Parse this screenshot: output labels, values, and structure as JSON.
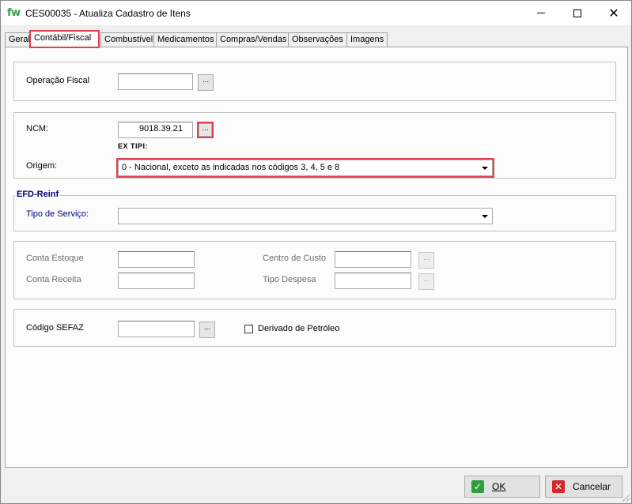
{
  "window": {
    "logo": "fw",
    "title": "CES00035 - Atualiza Cadastro de Itens",
    "controls": {
      "minimize": "minimize-icon",
      "maximize": "maximize-icon",
      "close": "close-icon"
    }
  },
  "tabs": [
    {
      "label": "Geral",
      "active": false
    },
    {
      "label": "Contábil/Fiscal",
      "active": true
    },
    {
      "label": "Combustível",
      "active": false
    },
    {
      "label": "Medicamentos",
      "active": false
    },
    {
      "label": "Compras/Vendas",
      "active": false
    },
    {
      "label": "Observações",
      "active": false
    },
    {
      "label": "Imagens",
      "active": false
    }
  ],
  "fiscal": {
    "operacao_label": "Operação Fiscal",
    "operacao_value": "",
    "dots": "..."
  },
  "ncm": {
    "ncm_label": "NCM:",
    "ncm_value": "9018.39.21",
    "extipi_label": "EX TIPI:",
    "origem_label": "Origem:",
    "origem_value": "0 - Nacional, exceto as indicadas nos códigos 3, 4, 5 e 8"
  },
  "efd": {
    "title": "EFD-Reinf",
    "tipo_servico_label": "Tipo de Serviço:",
    "tipo_servico_value": ""
  },
  "contas": {
    "conta_estoque_label": "Conta  Estoque",
    "conta_receita_label": "Conta Receita",
    "centro_custo_label": "Centro de Custo",
    "tipo_despesa_label": "Tipo Despesa"
  },
  "sefaz": {
    "codigo_label": "Código SEFAZ",
    "codigo_value": "",
    "derivado_label": "Derivado de Petróleo",
    "derivado_checked": false
  },
  "buttons": {
    "ok_label": "OK",
    "cancel_label": "Cancelar"
  }
}
